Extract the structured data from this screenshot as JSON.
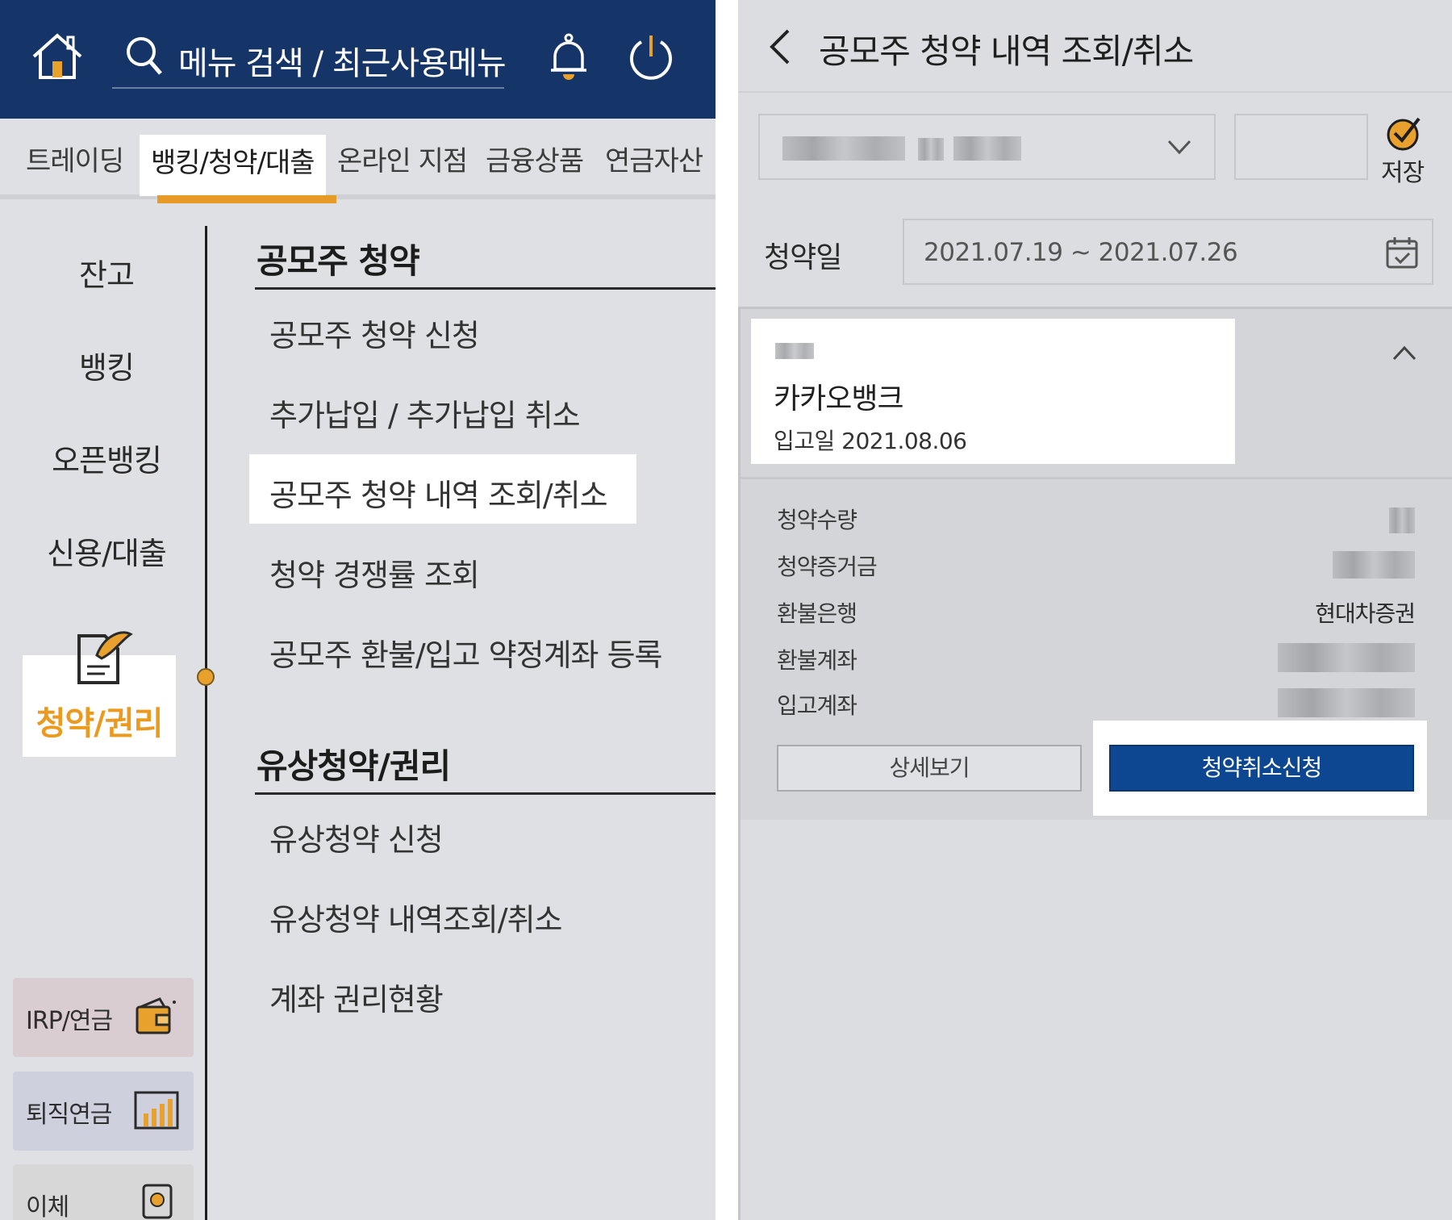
{
  "left": {
    "search_text": "메뉴 검색 / 최근사용메뉴",
    "tabs": [
      "트레이딩",
      "뱅킹/청약/대출",
      "온라인 지점",
      "금융상품",
      "연금자산"
    ],
    "side_nav": [
      "잔고",
      "뱅킹",
      "오픈뱅킹",
      "신용/대출"
    ],
    "side_nav_active": "청약/권리",
    "shortcuts": [
      {
        "label": "IRP/연금",
        "icon": "wallet-icon",
        "color": "#d9cdd1"
      },
      {
        "label": "퇴직연금",
        "icon": "bar-chart-icon",
        "color": "#cfd0dd"
      },
      {
        "label": "이체",
        "icon": "transfer-icon",
        "color": "#d8d7d7"
      }
    ],
    "sections": [
      {
        "title": "공모주 청약",
        "items": [
          "공모주 청약 신청",
          "추가납입 / 추가납입 취소",
          "공모주 청약 내역 조회/취소",
          "청약 경쟁률 조회",
          "공모주 환불/입고 약정계좌 등록"
        ]
      },
      {
        "title": "유상청약/권리",
        "items": [
          "유상청약 신청",
          "유상청약 내역조회/취소",
          "계좌 권리현황"
        ]
      }
    ],
    "active_tab_color": "#e89a27",
    "header_color": "#153569"
  },
  "right": {
    "title": "공모주 청약 내역 조회/취소",
    "save_label": "저장",
    "date_label": "청약일",
    "date_range": "2021.07.19 ~ 2021.07.26",
    "card": {
      "bank": "카카오뱅크",
      "receipt_date": "입고일 2021.08.06",
      "rows": [
        {
          "label": "청약수량",
          "value": ""
        },
        {
          "label": "청약증거금",
          "value": ""
        },
        {
          "label": "환불은행",
          "value": "현대차증권"
        },
        {
          "label": "환불계좌",
          "value": ""
        },
        {
          "label": "입고계좌",
          "value": ""
        }
      ],
      "detail_button": "상세보기",
      "cancel_button": "청약취소신청"
    },
    "primary_color": "#0d4792"
  }
}
